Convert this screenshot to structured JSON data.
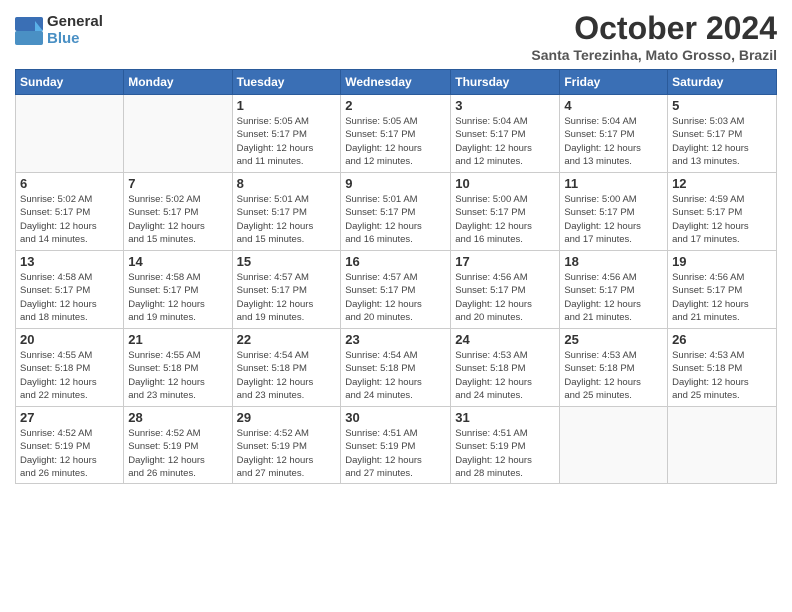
{
  "logo": {
    "general": "General",
    "blue": "Blue"
  },
  "title": "October 2024",
  "subtitle": "Santa Terezinha, Mato Grosso, Brazil",
  "weekdays": [
    "Sunday",
    "Monday",
    "Tuesday",
    "Wednesday",
    "Thursday",
    "Friday",
    "Saturday"
  ],
  "weeks": [
    [
      {
        "day": "",
        "info": ""
      },
      {
        "day": "",
        "info": ""
      },
      {
        "day": "1",
        "info": "Sunrise: 5:05 AM\nSunset: 5:17 PM\nDaylight: 12 hours\nand 11 minutes."
      },
      {
        "day": "2",
        "info": "Sunrise: 5:05 AM\nSunset: 5:17 PM\nDaylight: 12 hours\nand 12 minutes."
      },
      {
        "day": "3",
        "info": "Sunrise: 5:04 AM\nSunset: 5:17 PM\nDaylight: 12 hours\nand 12 minutes."
      },
      {
        "day": "4",
        "info": "Sunrise: 5:04 AM\nSunset: 5:17 PM\nDaylight: 12 hours\nand 13 minutes."
      },
      {
        "day": "5",
        "info": "Sunrise: 5:03 AM\nSunset: 5:17 PM\nDaylight: 12 hours\nand 13 minutes."
      }
    ],
    [
      {
        "day": "6",
        "info": "Sunrise: 5:02 AM\nSunset: 5:17 PM\nDaylight: 12 hours\nand 14 minutes."
      },
      {
        "day": "7",
        "info": "Sunrise: 5:02 AM\nSunset: 5:17 PM\nDaylight: 12 hours\nand 15 minutes."
      },
      {
        "day": "8",
        "info": "Sunrise: 5:01 AM\nSunset: 5:17 PM\nDaylight: 12 hours\nand 15 minutes."
      },
      {
        "day": "9",
        "info": "Sunrise: 5:01 AM\nSunset: 5:17 PM\nDaylight: 12 hours\nand 16 minutes."
      },
      {
        "day": "10",
        "info": "Sunrise: 5:00 AM\nSunset: 5:17 PM\nDaylight: 12 hours\nand 16 minutes."
      },
      {
        "day": "11",
        "info": "Sunrise: 5:00 AM\nSunset: 5:17 PM\nDaylight: 12 hours\nand 17 minutes."
      },
      {
        "day": "12",
        "info": "Sunrise: 4:59 AM\nSunset: 5:17 PM\nDaylight: 12 hours\nand 17 minutes."
      }
    ],
    [
      {
        "day": "13",
        "info": "Sunrise: 4:58 AM\nSunset: 5:17 PM\nDaylight: 12 hours\nand 18 minutes."
      },
      {
        "day": "14",
        "info": "Sunrise: 4:58 AM\nSunset: 5:17 PM\nDaylight: 12 hours\nand 19 minutes."
      },
      {
        "day": "15",
        "info": "Sunrise: 4:57 AM\nSunset: 5:17 PM\nDaylight: 12 hours\nand 19 minutes."
      },
      {
        "day": "16",
        "info": "Sunrise: 4:57 AM\nSunset: 5:17 PM\nDaylight: 12 hours\nand 20 minutes."
      },
      {
        "day": "17",
        "info": "Sunrise: 4:56 AM\nSunset: 5:17 PM\nDaylight: 12 hours\nand 20 minutes."
      },
      {
        "day": "18",
        "info": "Sunrise: 4:56 AM\nSunset: 5:17 PM\nDaylight: 12 hours\nand 21 minutes."
      },
      {
        "day": "19",
        "info": "Sunrise: 4:56 AM\nSunset: 5:17 PM\nDaylight: 12 hours\nand 21 minutes."
      }
    ],
    [
      {
        "day": "20",
        "info": "Sunrise: 4:55 AM\nSunset: 5:18 PM\nDaylight: 12 hours\nand 22 minutes."
      },
      {
        "day": "21",
        "info": "Sunrise: 4:55 AM\nSunset: 5:18 PM\nDaylight: 12 hours\nand 23 minutes."
      },
      {
        "day": "22",
        "info": "Sunrise: 4:54 AM\nSunset: 5:18 PM\nDaylight: 12 hours\nand 23 minutes."
      },
      {
        "day": "23",
        "info": "Sunrise: 4:54 AM\nSunset: 5:18 PM\nDaylight: 12 hours\nand 24 minutes."
      },
      {
        "day": "24",
        "info": "Sunrise: 4:53 AM\nSunset: 5:18 PM\nDaylight: 12 hours\nand 24 minutes."
      },
      {
        "day": "25",
        "info": "Sunrise: 4:53 AM\nSunset: 5:18 PM\nDaylight: 12 hours\nand 25 minutes."
      },
      {
        "day": "26",
        "info": "Sunrise: 4:53 AM\nSunset: 5:18 PM\nDaylight: 12 hours\nand 25 minutes."
      }
    ],
    [
      {
        "day": "27",
        "info": "Sunrise: 4:52 AM\nSunset: 5:19 PM\nDaylight: 12 hours\nand 26 minutes."
      },
      {
        "day": "28",
        "info": "Sunrise: 4:52 AM\nSunset: 5:19 PM\nDaylight: 12 hours\nand 26 minutes."
      },
      {
        "day": "29",
        "info": "Sunrise: 4:52 AM\nSunset: 5:19 PM\nDaylight: 12 hours\nand 27 minutes."
      },
      {
        "day": "30",
        "info": "Sunrise: 4:51 AM\nSunset: 5:19 PM\nDaylight: 12 hours\nand 27 minutes."
      },
      {
        "day": "31",
        "info": "Sunrise: 4:51 AM\nSunset: 5:19 PM\nDaylight: 12 hours\nand 28 minutes."
      },
      {
        "day": "",
        "info": ""
      },
      {
        "day": "",
        "info": ""
      }
    ]
  ]
}
